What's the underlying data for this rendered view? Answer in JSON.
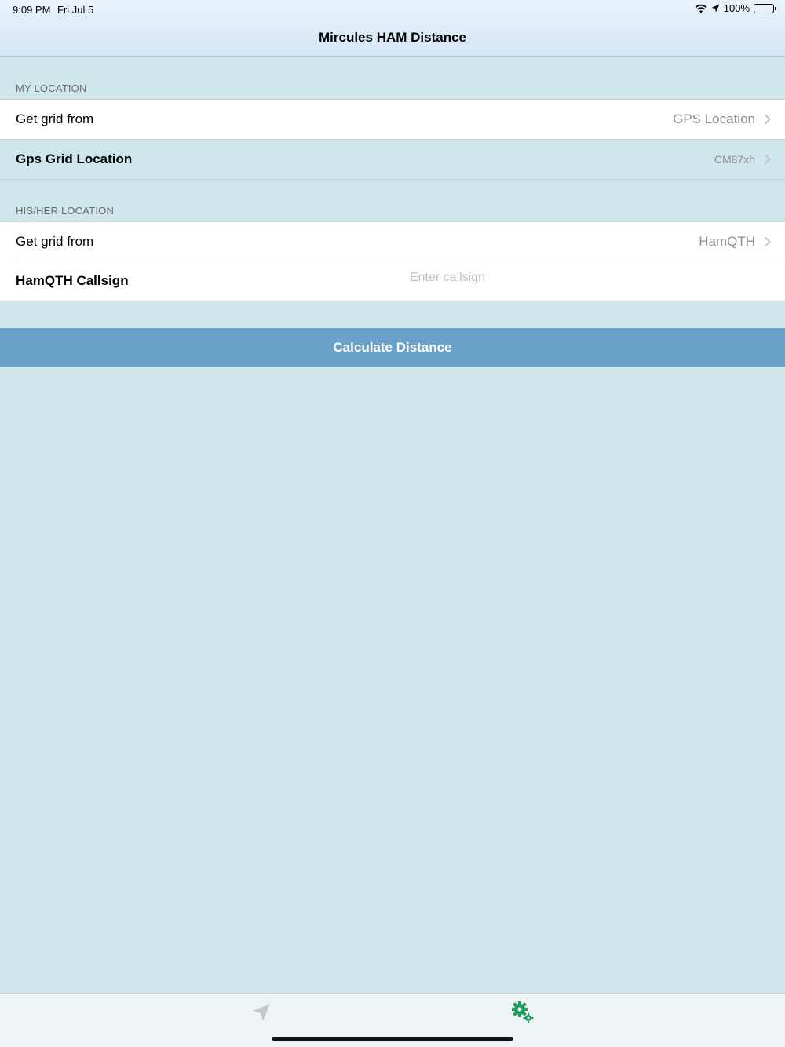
{
  "status_bar": {
    "time": "9:09 PM",
    "date": "Fri Jul 5",
    "battery_percent": "100%"
  },
  "nav": {
    "title": "Mircules HAM Distance"
  },
  "my_location": {
    "header": "MY LOCATION",
    "grid_source_label": "Get grid from",
    "grid_source_value": "GPS Location",
    "gps_grid_label": "Gps Grid Location",
    "gps_grid_value": "CM87xh"
  },
  "their_location": {
    "header": "HIS/HER LOCATION",
    "grid_source_label": "Get grid from",
    "grid_source_value": "HamQTH",
    "callsign_label": "HamQTH Callsign",
    "callsign_value": "",
    "callsign_placeholder": "Enter callsign"
  },
  "actions": {
    "calculate_label": "Calculate Distance"
  },
  "tab_bar": {
    "tabs": [
      {
        "icon": "location-arrow-icon",
        "active": false
      },
      {
        "icon": "gears-icon",
        "active": true
      }
    ]
  },
  "colors": {
    "background": "#cfe6ea",
    "button": "#6ba2ca",
    "active_tab": "#1f9a5a",
    "inactive_tab": "#c3c9cb"
  }
}
